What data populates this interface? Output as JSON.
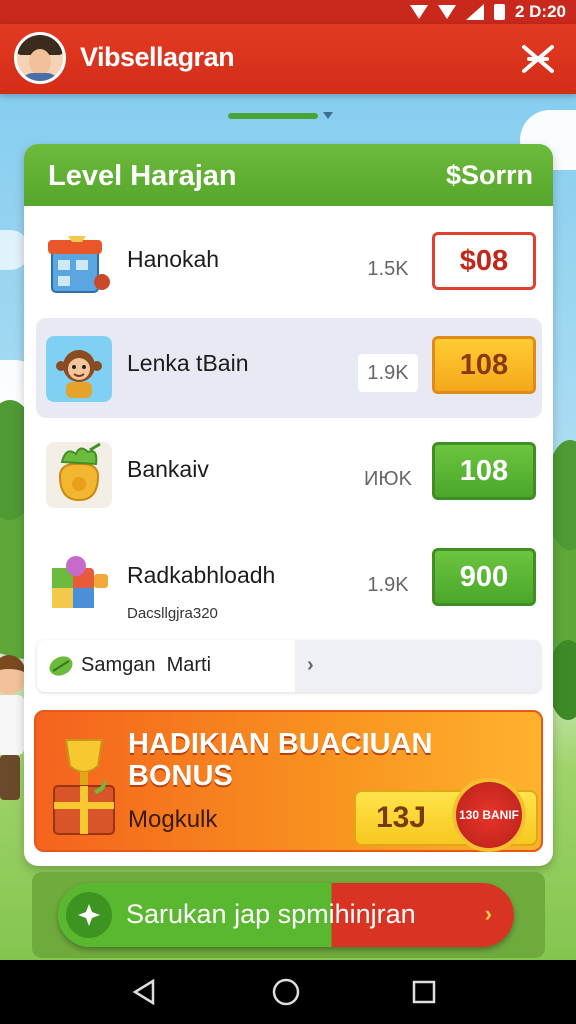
{
  "status_bar": {
    "time": "2 D:20"
  },
  "app_bar": {
    "title": "Vibsellagran"
  },
  "card": {
    "title": "Level Harajan",
    "header_right": "$Sorrn",
    "rows": [
      {
        "name": "Hanokah",
        "subtitle": "",
        "stat": "1.5K",
        "button": "$08",
        "icon": "store-building-icon"
      },
      {
        "name": "Lenka tBain",
        "subtitle": "",
        "stat": "1.9K",
        "button": "108",
        "icon": "monkey-avatar-icon"
      },
      {
        "name": "Bankaiv",
        "subtitle": "",
        "stat": "ИЮK",
        "button": "108",
        "icon": "money-bag-icon"
      },
      {
        "name": "Radkabhloadh",
        "subtitle": "Dacsllgjra320",
        "stat": "1.9K",
        "button": "900",
        "icon": "toy-box-icon"
      }
    ],
    "search": {
      "text": "Samgan  Marti",
      "icon": "leaf-icon"
    },
    "bonus": {
      "title": "HADIKIAN BUACIUAN BONUS",
      "subtitle": "Mogkulk",
      "value": "13J",
      "badge": "130 BANIF"
    }
  },
  "cta": {
    "label": "Sarukan jap spmihinjran"
  },
  "colors": {
    "brand_red": "#d42d18",
    "brand_green": "#55a62b",
    "accent_orange": "#f8901f",
    "accent_yellow": "#f7c820"
  }
}
